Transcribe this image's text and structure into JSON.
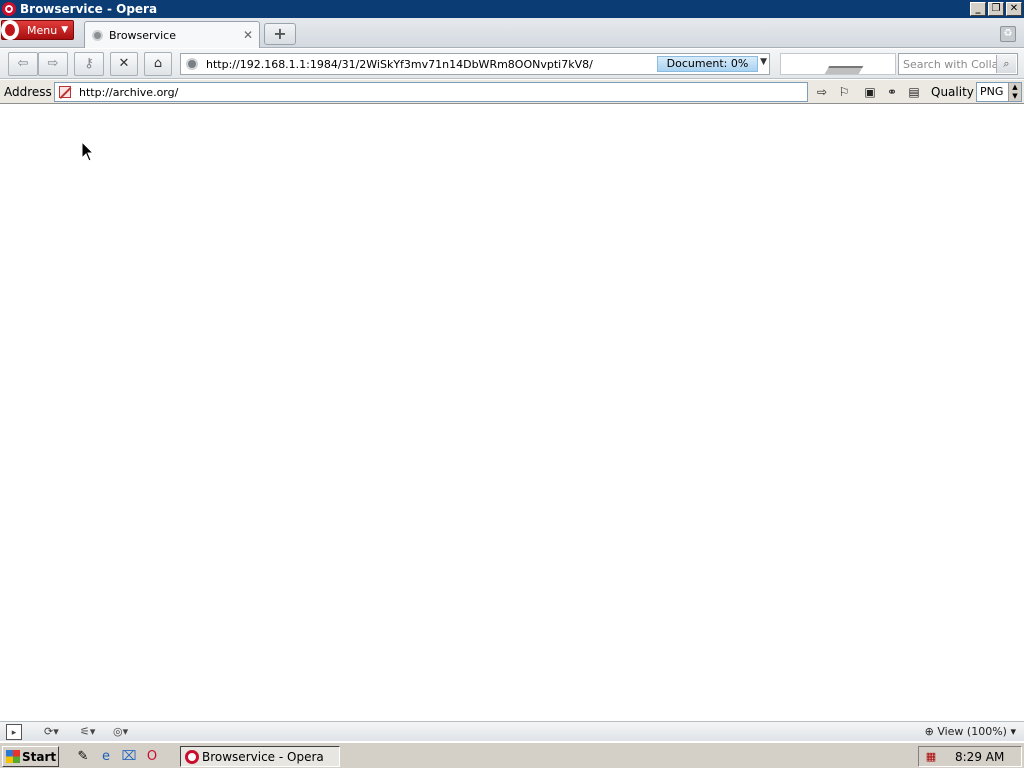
{
  "window": {
    "title": "Browservice - Opera",
    "controls": {
      "minimize": "_",
      "restore": "❐",
      "close": "✕"
    }
  },
  "tabbar": {
    "menu_label": "Menu",
    "tabs": [
      {
        "title": "Browservice",
        "active": true
      }
    ],
    "new_tab": "+"
  },
  "navbar": {
    "buttons": [
      "back",
      "forward",
      "key",
      "stop",
      "home"
    ],
    "url": "http://192.168.1.1:1984/31/2WiSkYf3mv71n14DbWRm8OONvpti7kV8/",
    "progress_label": "Document:  0%",
    "search_placeholder": "Search with Collab"
  },
  "addressbar": {
    "label": "Address",
    "value": "http://archive.org/",
    "quality_label": "Quality",
    "quality_value": "PNG"
  },
  "statusbar": {
    "zoom_label": "View (100%)"
  },
  "taskbar": {
    "start_label": "Start",
    "quick_launch": [
      "show-desktop-icon",
      "ie-icon",
      "network-icon",
      "opera-icon"
    ],
    "task_items": [
      {
        "label": "Browservice - Opera",
        "active": true
      }
    ],
    "clock": "8:29 AM"
  },
  "colors": {
    "titlebar": "#0b3d74",
    "opera_red": "#c8102e",
    "progress": "#a9d2f1",
    "taskbar": "#d4d0c8"
  }
}
